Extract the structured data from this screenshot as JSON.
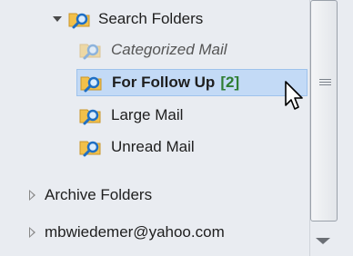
{
  "tree": {
    "search_folders": {
      "label": "Search Folders",
      "expanded": true
    },
    "children": [
      {
        "label": "Categorized Mail",
        "style": "italic"
      },
      {
        "label": "For Follow Up",
        "count": "[2]",
        "selected": true,
        "style": "bold"
      },
      {
        "label": "Large Mail",
        "style": "normal"
      },
      {
        "label": "Unread Mail",
        "style": "normal"
      }
    ],
    "archive_folders": {
      "label": "Archive Folders",
      "expanded": false
    },
    "account": {
      "label": "mbwiedemer@yahoo.com",
      "expanded": false
    }
  },
  "icons": {
    "search_folder": "search-folder-icon",
    "cursor": "mouse-pointer-icon"
  },
  "colors": {
    "selection": "#c3daf6",
    "count": "#2e7d32",
    "folder": "#f2c04a",
    "magnifier": "#1f6fc4"
  }
}
